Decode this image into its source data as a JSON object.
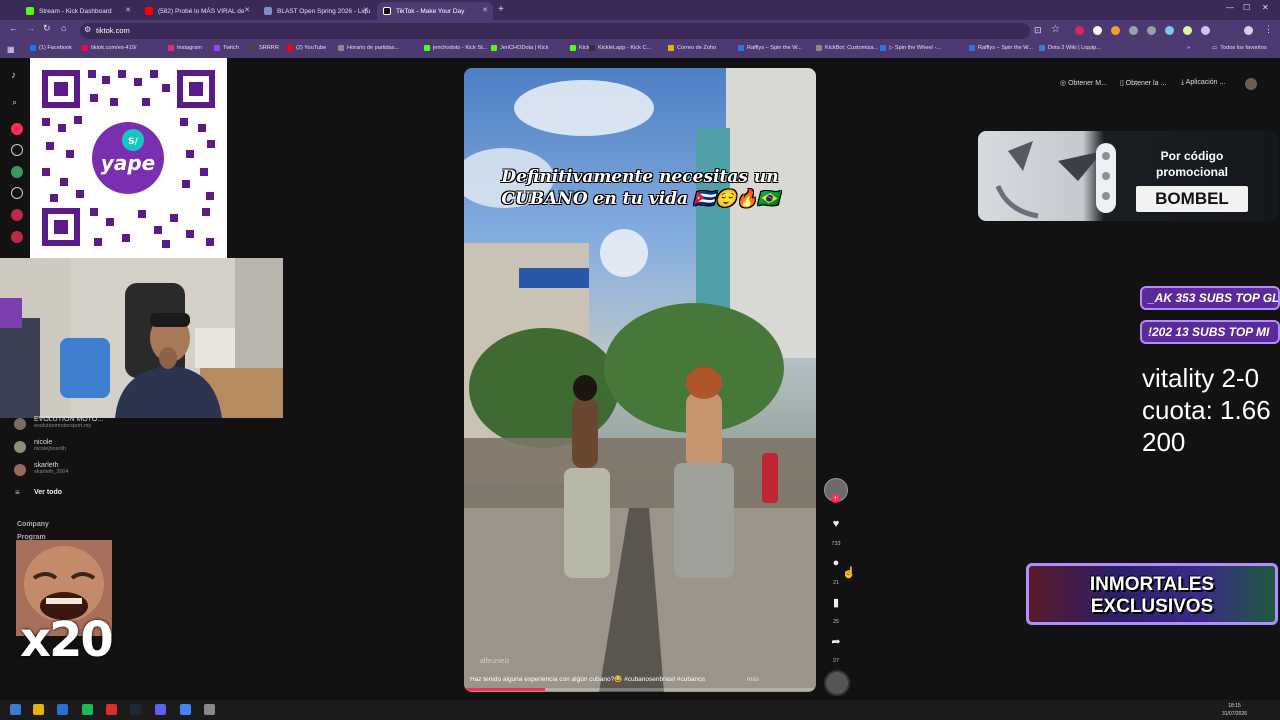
{
  "browser": {
    "tabs": [
      {
        "title": "Stream - Kick Dashboard",
        "color": "#53fc18",
        "active": false
      },
      {
        "title": "(582) Probé lo MÁS VIRAL de",
        "color": "#ff0000",
        "active": false
      },
      {
        "title": "BLAST Open Spring 2026 - Liqu",
        "color": "#7b8ec8",
        "active": false
      },
      {
        "title": "TikTok - Make Your Day",
        "color": "#111111",
        "active": true
      }
    ],
    "url": "tiktok.com",
    "bookmarks": [
      {
        "label": "(1) Facebook",
        "color": "#1877f2"
      },
      {
        "label": "tiktok.com/es-419/",
        "color": "#ff0050"
      },
      {
        "label": "Instagram",
        "color": "#e1306c"
      },
      {
        "label": "Twitch",
        "color": "#9146ff"
      },
      {
        "label": "SRRRR",
        "color": "#444444"
      },
      {
        "label": "(2) YouTube",
        "color": "#ff0000"
      },
      {
        "label": "Horario de partidas...",
        "color": "#888888"
      },
      {
        "label": "jerichodoto - Kick St...",
        "color": "#53fc18"
      },
      {
        "label": "JeriCHODota | Kick",
        "color": "#53fc18"
      },
      {
        "label": "Kick",
        "color": "#53fc18"
      },
      {
        "label": "Kicklet.app - Kick C...",
        "color": "#333333"
      },
      {
        "label": "Correo de Zoho",
        "color": "#e8b400"
      },
      {
        "label": "Rafflys – Spin the W...",
        "color": "#2a7ae2"
      },
      {
        "label": "KickBot: Customiza...",
        "color": "#888888"
      },
      {
        "label": "▷ Spin the Wheel -...",
        "color": "#2a7ae2"
      },
      {
        "label": "Rafflys – Spin the W...",
        "color": "#2a7ae2"
      },
      {
        "label": "Dota 2 Wiki | Liquip...",
        "color": "#3a7bd5"
      }
    ],
    "all_bookmarks": "Todos los favoritos"
  },
  "sidebar": {
    "accounts": [
      {
        "name": "EVOLUTION MOTO...",
        "handle": "evolutionmotorsport.my"
      },
      {
        "name": "nicole",
        "handle": "nicolejhosnth"
      },
      {
        "name": "skarleth",
        "handle": "skarleth_2004"
      }
    ],
    "see_all": "Ver todo",
    "company": "Company",
    "program": "Program"
  },
  "overlays": {
    "multiplier": "x20",
    "promo_label": "Por código promocional",
    "promo_code": "BOMBEL",
    "subs_line_1": "_AK 353 SUBS  TOP GLOI",
    "subs_line_2": "!202 13 SUBS    TOP MI",
    "bet_info": "vitality 2-0\ncuota: 1.66\n200",
    "inmortales": "INMORTALES EXCLUSIVOS"
  },
  "topbar": {
    "get_coins": "Obtener M...",
    "get_app": "Obtener la ...",
    "app": "Aplicación ..."
  },
  "video": {
    "title": "Definitivamente necesitas un CUBANO en tu vida 🇨🇺😌🔥🇧🇷",
    "username": "alfeunielz",
    "caption": "Haz tenido alguna experiencia con algún cubano?😂 #cubanosenbrasil #cubanos",
    "more": "más",
    "progress_percent": 23,
    "likes": "733",
    "comments": "21",
    "saves": "25",
    "shares": "27"
  },
  "taskbar": {
    "time": "18:15",
    "date": "31/07/2026"
  }
}
